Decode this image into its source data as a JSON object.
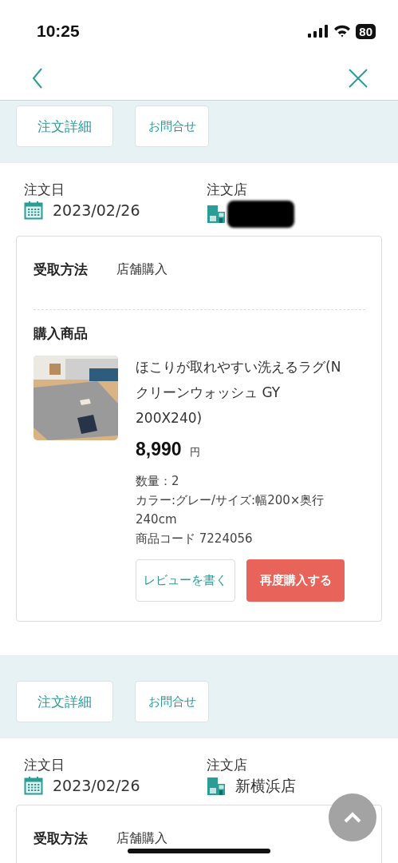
{
  "status_bar": {
    "time": "10:25",
    "battery": "80"
  },
  "orders": [
    {
      "detail_button": "注文詳細",
      "inquiry_button": "お問合せ",
      "order_date_label": "注文日",
      "order_date": "2023/02/26",
      "store_label": "注文店",
      "store_redacted": true,
      "pickup_label": "受取方法",
      "pickup_value": "店舗購入",
      "items_heading": "購入商品",
      "items": [
        {
          "kind": "picture",
          "name": "ほこりが取れやすい洗えるラグ(Nクリーンウォッシュ GY 200X240)",
          "price": "8,990",
          "currency": "円",
          "quantity": "数量：2",
          "variant": "カラー:グレー/サイズ:幅200×奥行240cm",
          "code": "商品コード 7224056",
          "review_button": "レビューを書く",
          "rebuy_button": "再度購入する"
        }
      ]
    },
    {
      "detail_button": "注文詳細",
      "inquiry_button": "お問合せ",
      "order_date_label": "注文日",
      "order_date": "2023/02/26",
      "store_label": "注文店",
      "store_name": "新横浜店",
      "pickup_label": "受取方法",
      "pickup_value": "店舗購入"
    }
  ]
}
